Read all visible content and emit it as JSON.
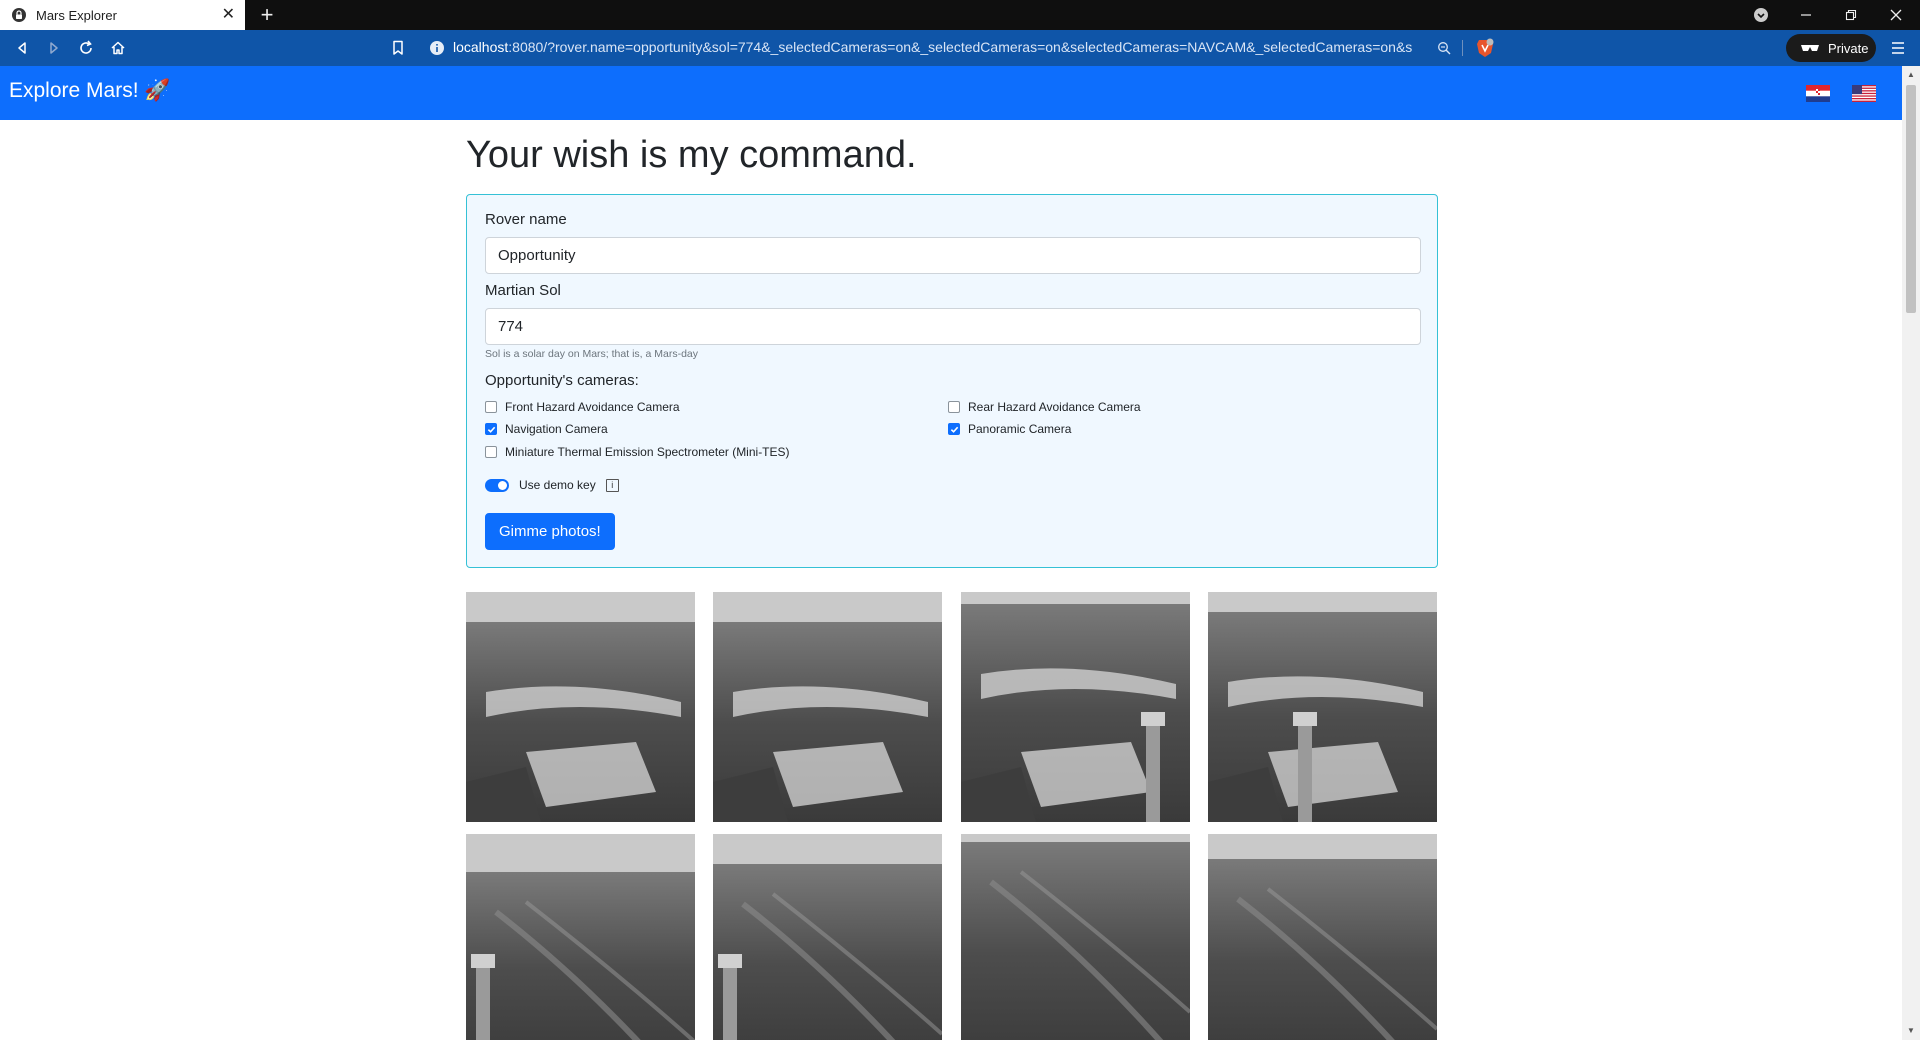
{
  "browser": {
    "tab_title": "Mars Explorer",
    "new_tab": "+",
    "url_host": "localhost",
    "url_rest": ":8080/?rover.name=opportunity&sol=774&_selectedCameras=on&_selectedCameras=on&selectedCameras=NAVCAM&_selectedCameras=on&s...",
    "private_label": "Private"
  },
  "navbar": {
    "brand": "Explore Mars! 🚀",
    "flags": [
      "croatian-flag-icon",
      "us-flag-icon"
    ]
  },
  "main": {
    "heading": "Your wish is my command.",
    "rover_label": "Rover name",
    "rover_value": "Opportunity",
    "sol_label": "Martian Sol",
    "sol_value": "774",
    "sol_help": "Sol is a solar day on Mars; that is, a Mars-day",
    "cameras_title": "Opportunity's cameras:",
    "cameras": [
      {
        "label": "Front Hazard Avoidance Camera",
        "checked": false
      },
      {
        "label": "Rear Hazard Avoidance Camera",
        "checked": false
      },
      {
        "label": "Navigation Camera",
        "checked": true
      },
      {
        "label": "Panoramic Camera",
        "checked": true
      },
      {
        "label": "Miniature Thermal Emission Spectrometer (Mini-TES)",
        "checked": false
      }
    ],
    "demo_key_label": "Use demo key",
    "demo_key_on": true,
    "info_glyph": "i",
    "submit_label": "Gimme photos!"
  },
  "colors": {
    "navbar": "#0d6efd",
    "browser_toolbar": "#0f55a8",
    "form_bg": "#f0f8ff",
    "form_border": "#35c1d6"
  }
}
